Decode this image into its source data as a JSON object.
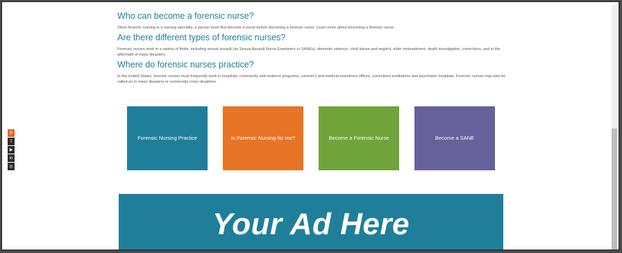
{
  "colors": {
    "heading": "#1f7f9a",
    "card1": "#1f7f9a",
    "card2": "#e87425",
    "card3": "#71a33b",
    "card4": "#67619b",
    "ad_background": "#1f7f9a",
    "search_icon_bg": "#e4692a"
  },
  "faq": [
    {
      "question": "Who can become a forensic nurse?",
      "answer": "Since forensic nursing is a nursing specialty, a person must first become a nurse before becoming a forensic nurse. Learn more about becoming a forensic nurse."
    },
    {
      "question": "Are there different types of forensic nurses?",
      "answer": "Forensic nurses work in a variety of fields, including sexual assault (as Sexual Assault Nurse Examiners or SANEs), domestic violence, child abuse and neglect, elder mistreatment, death investigation, corrections, and in the aftermath of mass disasters."
    },
    {
      "question": "Where do forensic nurses practice?",
      "answer": "In the United States, forensic nurses most frequently work in hospitals, community anti-violence programs, coroner's and medical examiners offices, corrections institutions and psychiatric hospitals. Forensic nurses may also be called on in mass disasters or community crisis situations."
    }
  ],
  "cards": [
    {
      "label": "Forensic Nursing Practice"
    },
    {
      "label": "Is Forensic Nursing for me?"
    },
    {
      "label": "Become a Forensic Nurse"
    },
    {
      "label": "Become a SANE"
    }
  ],
  "social": [
    {
      "icon": "search-icon",
      "glyph": "⚲"
    },
    {
      "icon": "facebook-icon",
      "glyph": "f"
    },
    {
      "icon": "youtube-icon",
      "glyph": "▶"
    },
    {
      "icon": "linkedin-icon",
      "glyph": "in"
    },
    {
      "icon": "instagram-icon",
      "glyph": "◎"
    }
  ],
  "ad": {
    "text": "Your Ad Here"
  }
}
